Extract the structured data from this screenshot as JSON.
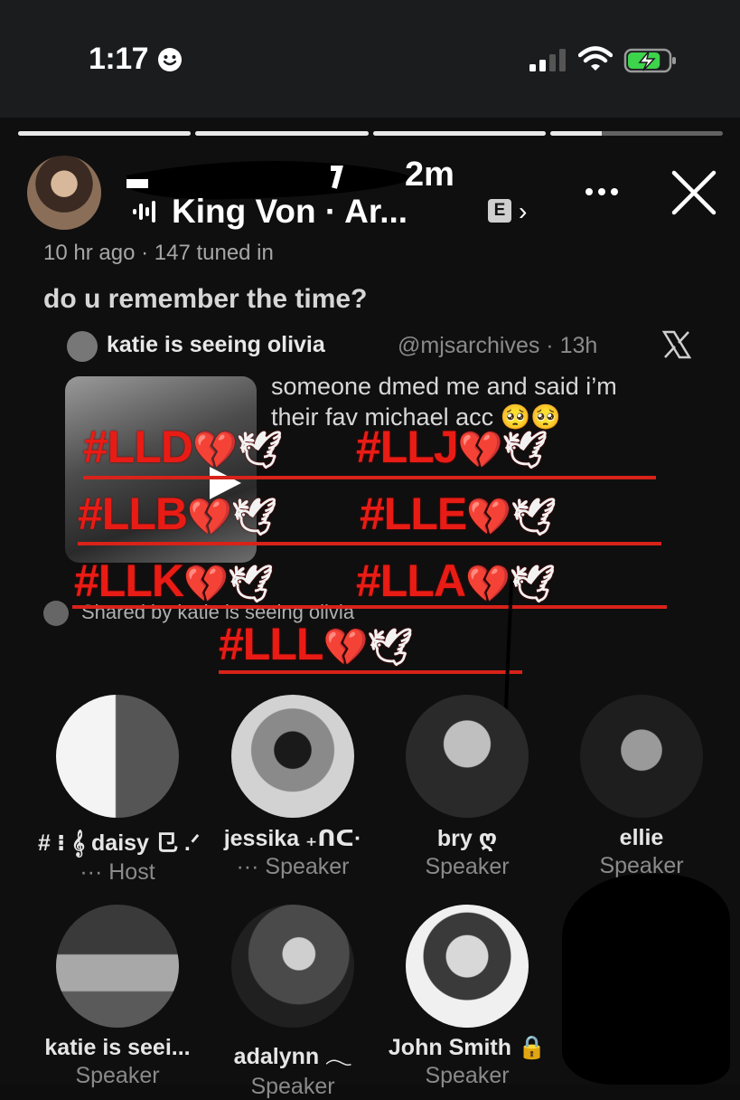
{
  "status_bar": {
    "time": "1:17",
    "battery_level": 0.8,
    "focus_icon": "smiley-icon",
    "signal_bars": 2
  },
  "story": {
    "progress": [
      1,
      1,
      1,
      0.3
    ],
    "age": "2m",
    "song": "King Von · Ar...",
    "explicit_badge": "E",
    "chevron": "›"
  },
  "space": {
    "meta": "10 hr ago · 147 tuned in",
    "title": "do u remember the time?"
  },
  "tweet": {
    "author": "katie is seeing olivia",
    "handle": "@mjsarchives · 13h",
    "text": "someone dmed me and said i’m their fav michael acc 🥺🥺"
  },
  "shared_by": "Shared by katie is seeing olivia",
  "stickers": [
    {
      "tag": "#LLD",
      "emoji": "💔",
      "dove": "🕊"
    },
    {
      "tag": "#LLJ",
      "emoji": "💔",
      "dove": "🕊"
    },
    {
      "tag": "#LLB",
      "emoji": "💔",
      "dove": "🕊"
    },
    {
      "tag": "#LLE",
      "emoji": "💔",
      "dove": "🕊"
    },
    {
      "tag": "#LLK",
      "emoji": "💔",
      "dove": "🕊"
    },
    {
      "tag": "#LLA",
      "emoji": "💔",
      "dove": "🕊"
    },
    {
      "tag": "#LLL",
      "emoji": "💔",
      "dove": "🕊"
    }
  ],
  "participants": [
    {
      "name": "# ⁝ 𝄞 daisy ⺋ .ᐟ",
      "role": "··· Host"
    },
    {
      "name": "jessika ₊ᑎᑕ·",
      "role": "··· Speaker"
    },
    {
      "name": "bry ღ",
      "role": "Speaker"
    },
    {
      "name": "ellie",
      "role": "Speaker"
    },
    {
      "name": "katie is seei...",
      "role": "Speaker"
    },
    {
      "name": "adalynn 𓂃",
      "role": "Speaker"
    },
    {
      "name": "John Smith 🔒",
      "role": "Speaker"
    }
  ],
  "colors": {
    "sticker_red": "#e81c15",
    "background": "#0f0f0f"
  }
}
